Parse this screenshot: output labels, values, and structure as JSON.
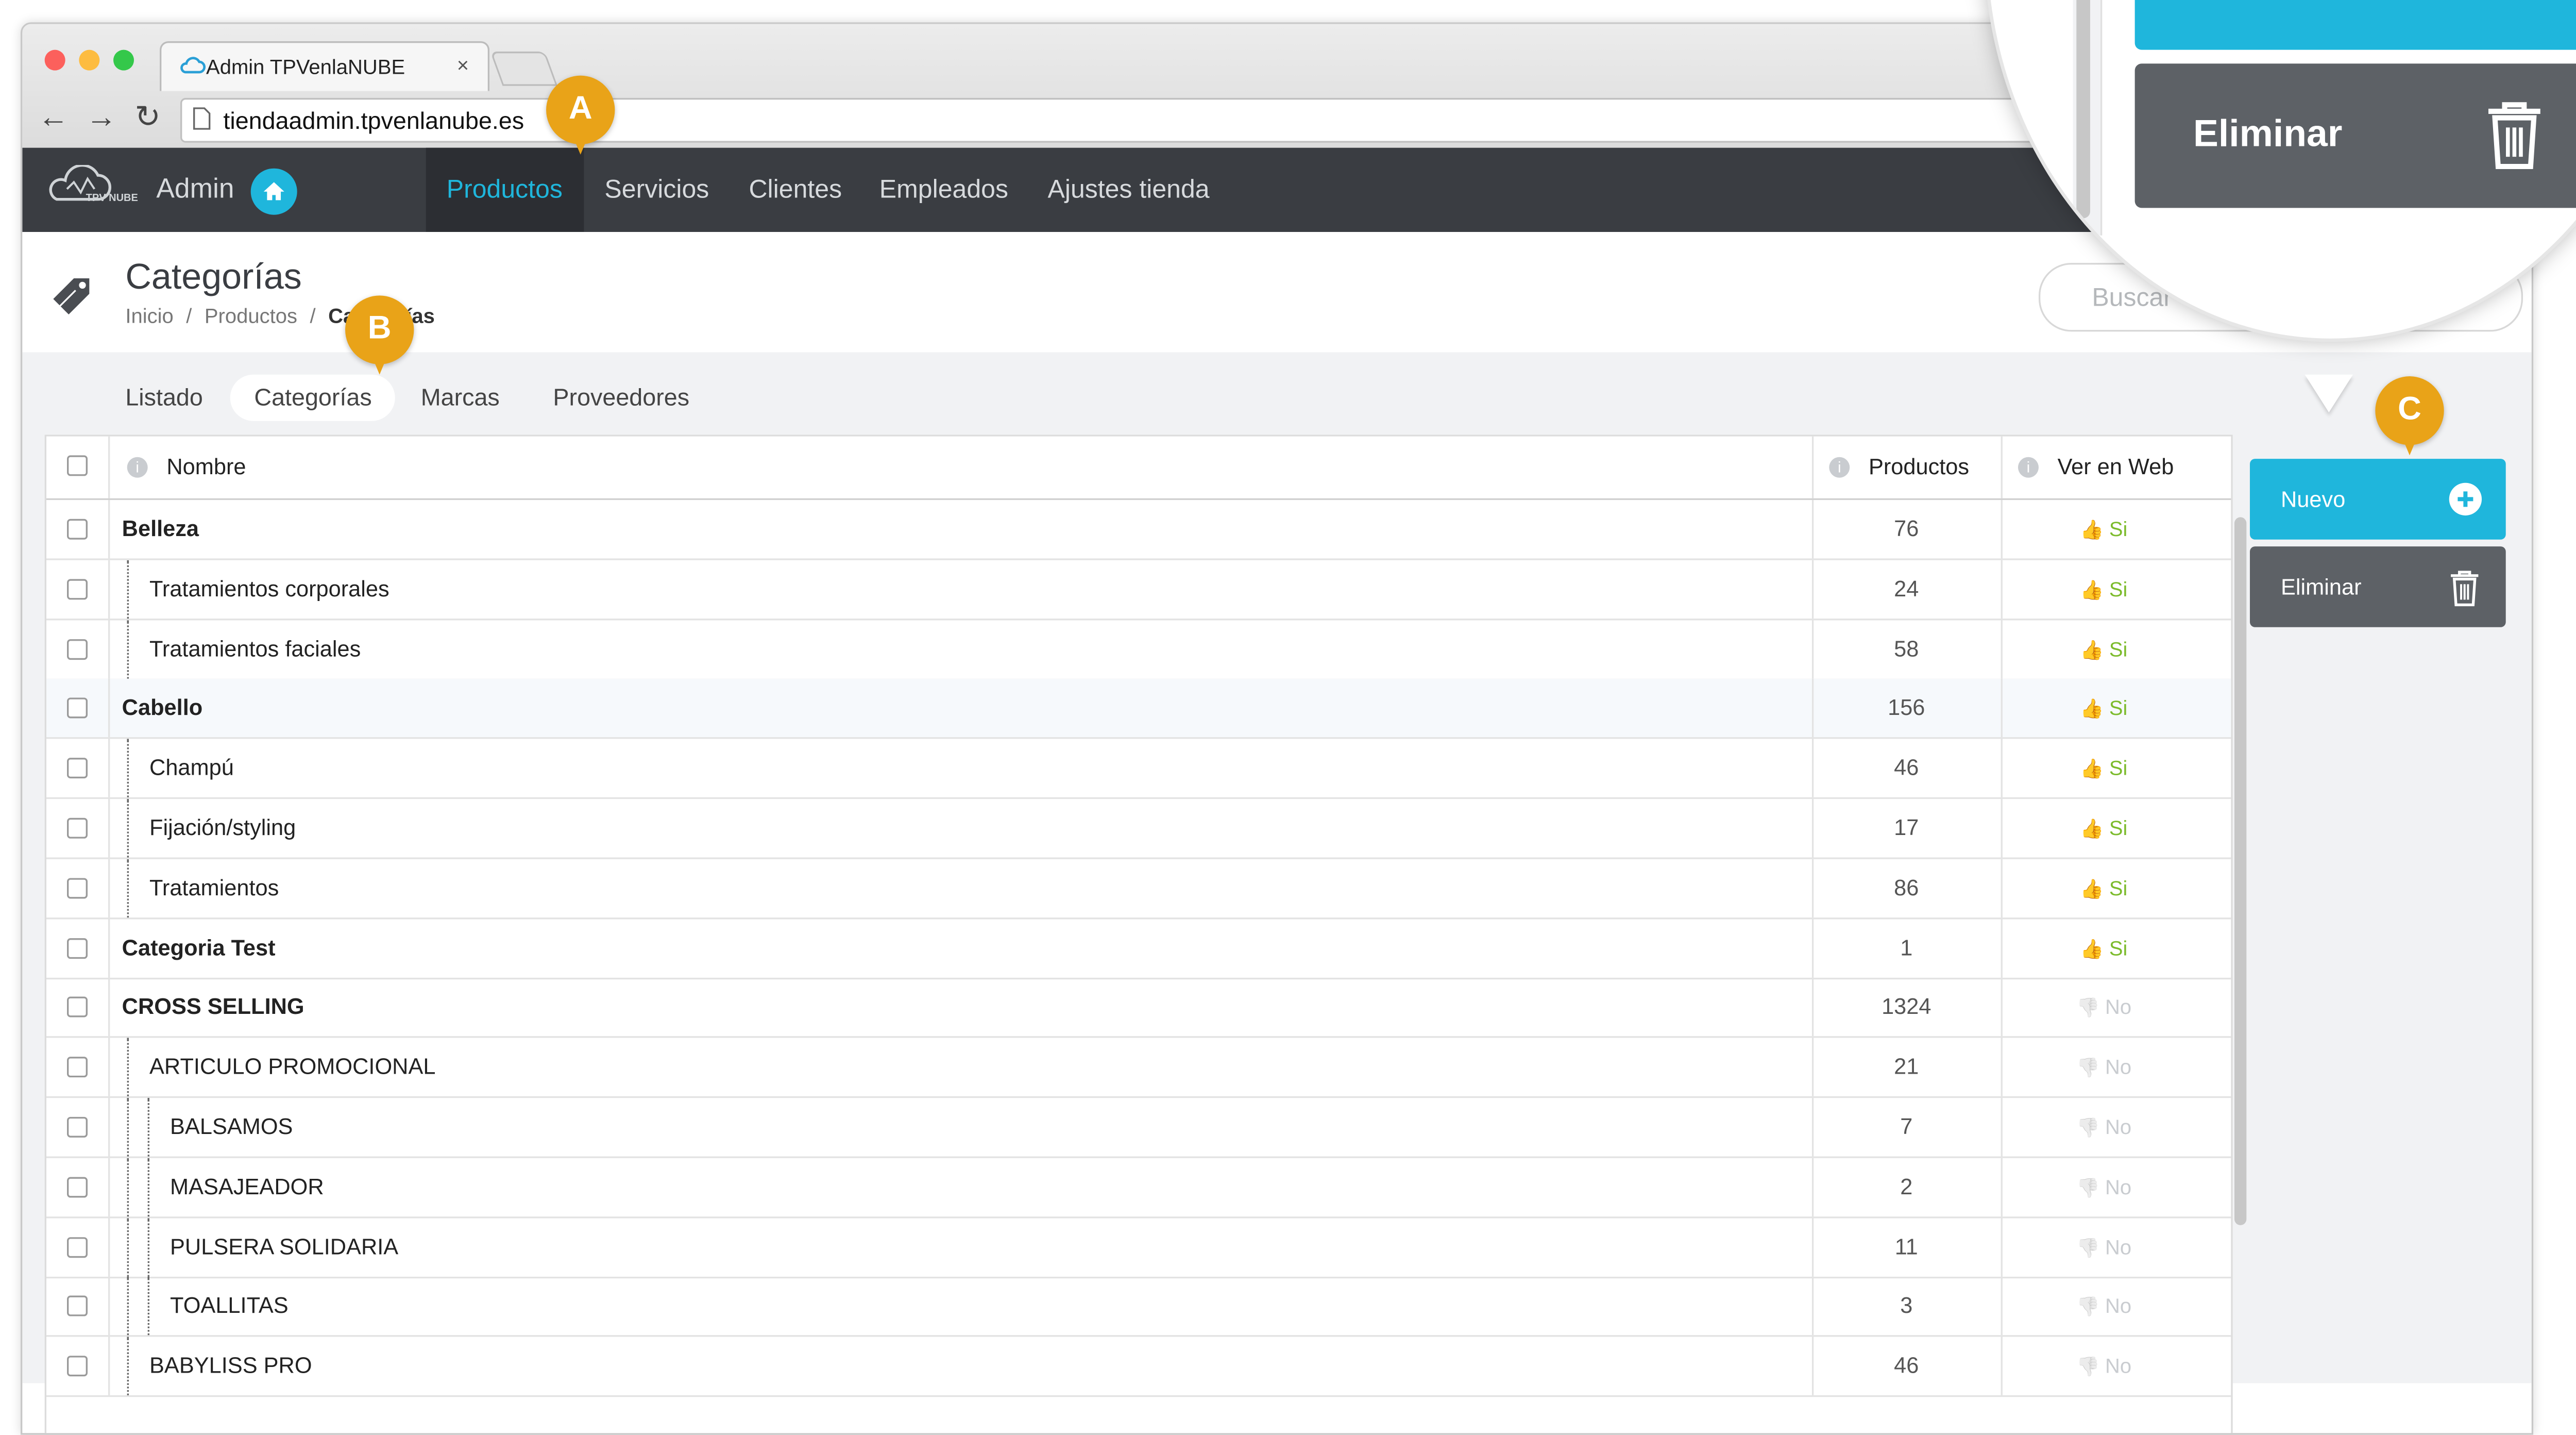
{
  "browser": {
    "tab_title": "Admin TPVenlaNUBE",
    "tab_close": "×",
    "url": "tiendaadmin.tpvenlanube.es"
  },
  "nav": {
    "logo_text": "TPV NUBE",
    "admin_label": "Admin",
    "items": [
      "Productos",
      "Servicios",
      "Clientes",
      "Empleados",
      "Ajustes tienda"
    ],
    "active": "Productos",
    "accent": "#1fb6dc"
  },
  "page": {
    "title": "Categorías",
    "breadcrumb": [
      "Inicio",
      "Productos",
      "Categorías"
    ],
    "breadcrumb_separator": "/",
    "search_placeholder": "Buscar"
  },
  "subtabs": {
    "items": [
      "Listado",
      "Categorías",
      "Marcas",
      "Proveedores"
    ],
    "active": "Categorías"
  },
  "table": {
    "columns": [
      "Nombre",
      "Productos",
      "Ver en Web"
    ],
    "rows": [
      {
        "name": "Belleza",
        "products": "76",
        "web": "Si",
        "level": 0
      },
      {
        "name": "Tratamientos corporales",
        "products": "24",
        "web": "Si",
        "level": 1
      },
      {
        "name": "Tratamientos faciales",
        "products": "58",
        "web": "Si",
        "level": 1
      },
      {
        "name": "Cabello",
        "products": "156",
        "web": "Si",
        "level": 0
      },
      {
        "name": "Champú",
        "products": "46",
        "web": "Si",
        "level": 1
      },
      {
        "name": "Fijación/styling",
        "products": "17",
        "web": "Si",
        "level": 1
      },
      {
        "name": "Tratamientos",
        "products": "86",
        "web": "Si",
        "level": 1
      },
      {
        "name": "Categoria Test",
        "products": "1",
        "web": "Si",
        "level": 0
      },
      {
        "name": "CROSS SELLING",
        "products": "1324",
        "web": "No",
        "level": 0
      },
      {
        "name": "ARTICULO PROMOCIONAL",
        "products": "21",
        "web": "No",
        "level": 1
      },
      {
        "name": "BALSAMOS",
        "products": "7",
        "web": "No",
        "level": 2
      },
      {
        "name": "MASAJEADOR",
        "products": "2",
        "web": "No",
        "level": 2
      },
      {
        "name": "PULSERA SOLIDARIA",
        "products": "11",
        "web": "No",
        "level": 2
      },
      {
        "name": "TOALLITAS",
        "products": "3",
        "web": "No",
        "level": 2
      },
      {
        "name": "BABYLISS PRO",
        "products": "46",
        "web": "No",
        "level": 1
      }
    ]
  },
  "actions": {
    "new_label": "Nuevo",
    "delete_label": "Eliminar",
    "new_color": "#1fb6dc",
    "delete_color": "#5d6166"
  },
  "magnifier": {
    "delete_label": "Eliminar"
  },
  "markers": [
    "A",
    "B",
    "C"
  ]
}
